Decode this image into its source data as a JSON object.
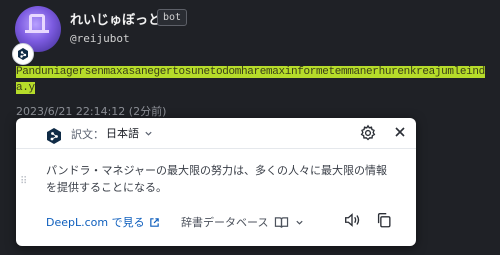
{
  "post": {
    "display_name": "れいじゅぼっと",
    "bot_badge": "bot",
    "username": "@reijubot",
    "text": "Panduniagersenmaxasanegertosunetodomharemaxinformetemmanerhurenkreajumleinda.y",
    "timestamp": "2023/6/21 22:14:12 (2分前)",
    "highlight_color": "#b6dc2a"
  },
  "popup": {
    "translation_label": "訳文：",
    "target_language": "日本語",
    "translated_text": "パンドラ・マネジャーの最大限の努力は、多くの人々に最大限の情報を提供することになる。",
    "deepl_link": "DeepL.com で見る",
    "dictionary_label": "辞書データベース"
  },
  "icons": {
    "avatar_badge": "deepl-logo-icon",
    "settings": "gear-icon",
    "close": "close-icon",
    "speaker": "speaker-icon",
    "copy": "copy-icon",
    "external": "external-link-icon",
    "book": "book-icon",
    "chevron": "chevron-down-icon"
  },
  "colors": {
    "background": "#1f2126",
    "accent_link": "#0f5fbd",
    "deepl_navy": "#0f2b46"
  }
}
